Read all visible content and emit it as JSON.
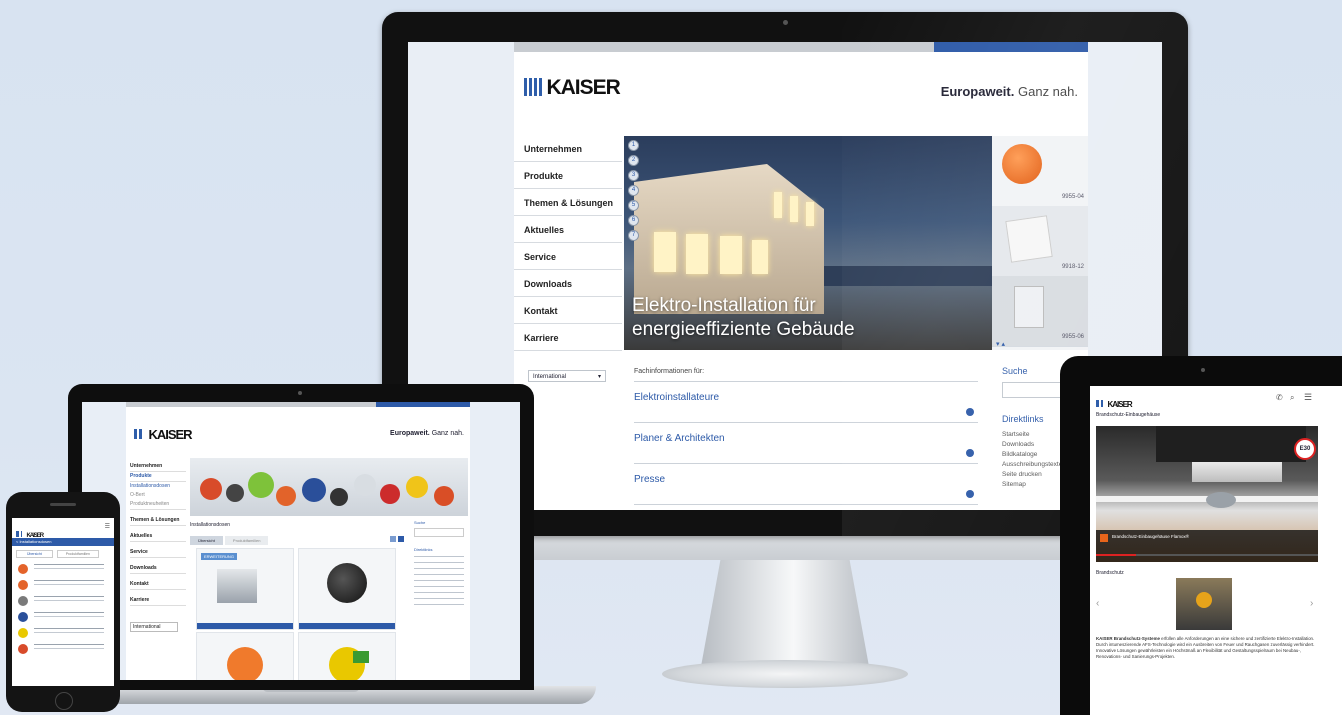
{
  "brand": {
    "name": "KAISER",
    "tagline_bold": "Europaweit.",
    "tagline_rest": "Ganz nah.",
    "brand_color": "#2d5aa8"
  },
  "desktop": {
    "nav": [
      "Unternehmen",
      "Produkte",
      "Themen & Lösungen",
      "Aktuelles",
      "Service",
      "Downloads",
      "Kontakt",
      "Karriere"
    ],
    "country_select": "International",
    "hero_title_line1": "Elektro-Installation für",
    "hero_title_line2": "energieeffiziente Gebäude",
    "slider_dots": [
      "1",
      "2",
      "3",
      "4",
      "5",
      "6",
      "7"
    ],
    "thumb_codes": [
      "9955-04",
      "9918-12",
      "9955-06"
    ],
    "fachinfo_label": "Fachinformationen für:",
    "fachinfo_links": [
      "Elektroinstallateure",
      "Planer & Architekten",
      "Presse"
    ],
    "search_label": "Suche",
    "direktlinks_title": "Direktlinks",
    "direktlinks": [
      "Startseite",
      "Downloads",
      "Bildkataloge",
      "Ausschreibungstexte",
      "Seite drucken",
      "Sitemap"
    ]
  },
  "laptop": {
    "nav": [
      "Unternehmen",
      "Produkte",
      "Installationsdosen",
      "O-Bert",
      "Produktneuheiten",
      "Themen & Lösungen",
      "Aktuelles",
      "Service",
      "Downloads",
      "Kontakt",
      "Karriere"
    ],
    "section_title": "Installationsdosen",
    "tabs": [
      "Übersicht",
      "Produktfamilien"
    ],
    "product_badge": "ERWEITERUNG",
    "search_label": "Suche",
    "direktlinks_title": "Direktlinks",
    "country_select": "International"
  },
  "phone": {
    "back_label": "< Installationsdosen",
    "tabs": [
      "Übersicht",
      "Produktfamilien"
    ]
  },
  "tablet": {
    "page_title": "Brandschutz-Einbaugehäuse",
    "video_title": "Brandschutz-Einbaugehäuse Flamox®",
    "speed_sign": "E30",
    "section_label": "Brandschutz",
    "body_bold": "KAISER Brandschutz-Systeme",
    "body_text": "erfüllen alle Anforderungen an eine sichere und zertifizierte Elektro-Installation. Durch intumeszierende AFS-Technologie wird ein Ausbreiten von Feuer und Rauchgasen zuverlässig verhindert. Innovative Lösungen gewährleisten ein Höchstmaß an Flexibilität und Gestaltungsspielraum bei Neubau-, Renovations- und Sanierungs-Projekten."
  }
}
